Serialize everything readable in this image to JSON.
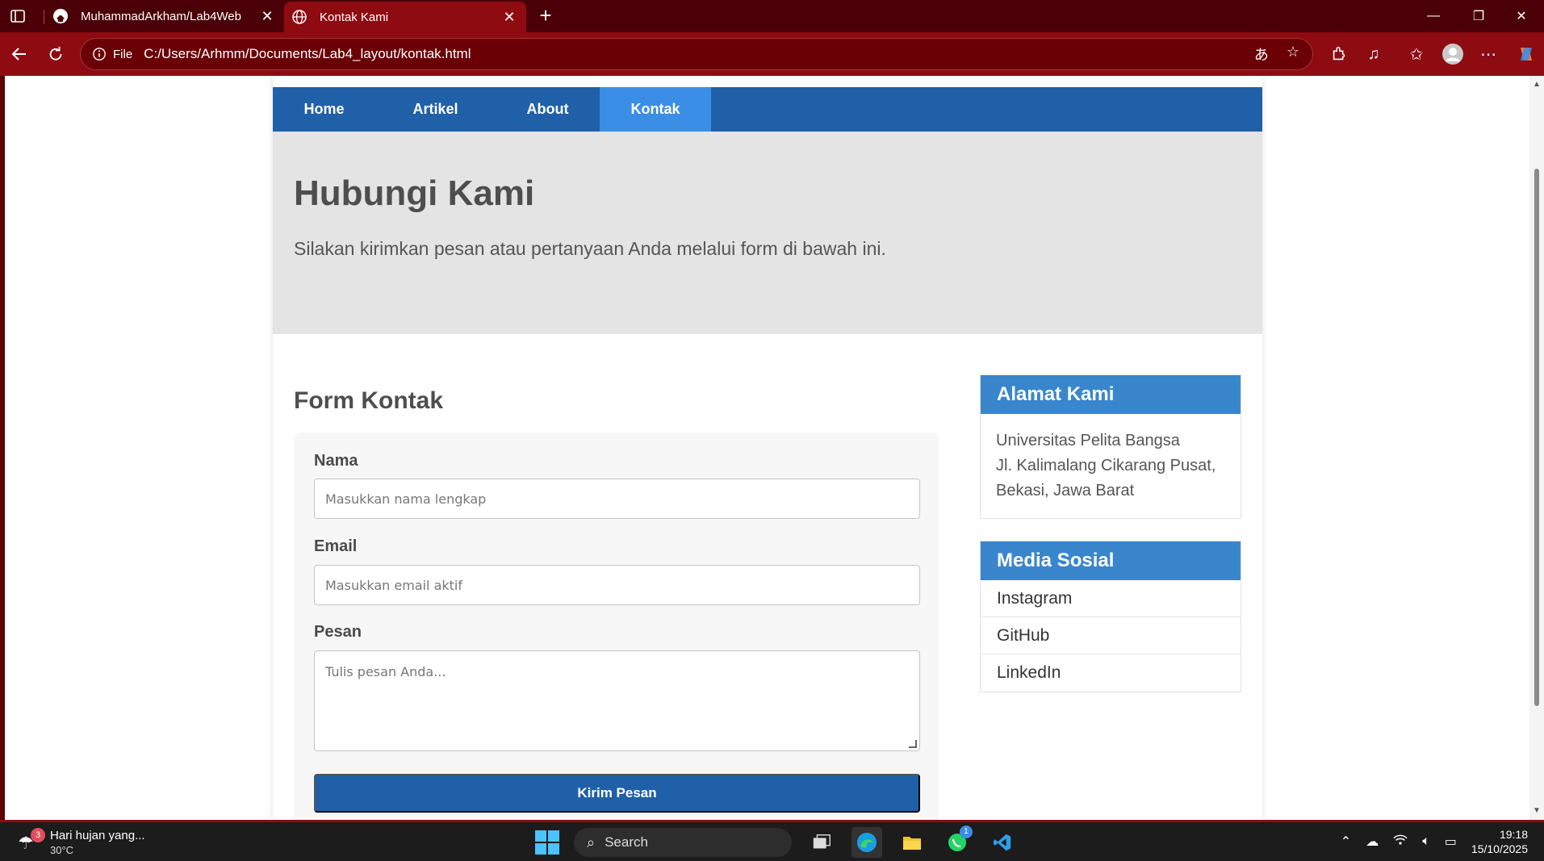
{
  "browser": {
    "tabs": [
      {
        "title": "MuhammadArkham/Lab4Web",
        "icon": "github-icon",
        "active": false
      },
      {
        "title": "Kontak Kami",
        "icon": "globe-icon",
        "active": true
      }
    ],
    "address": {
      "scheme_label": "File",
      "url": "C:/Users/Arhmm/Documents/Lab4_layout/kontak.html"
    }
  },
  "page": {
    "nav": [
      {
        "label": "Home",
        "active": false
      },
      {
        "label": "Artikel",
        "active": false
      },
      {
        "label": "About",
        "active": false
      },
      {
        "label": "Kontak",
        "active": true
      }
    ],
    "hero": {
      "title": "Hubungi Kami",
      "subtitle": "Silakan kirimkan pesan atau pertanyaan Anda melalui form di bawah ini."
    },
    "form": {
      "title": "Form Kontak",
      "name_label": "Nama",
      "name_placeholder": "Masukkan nama lengkap",
      "email_label": "Email",
      "email_placeholder": "Masukkan email aktif",
      "message_label": "Pesan",
      "message_placeholder": "Tulis pesan Anda...",
      "submit_label": "Kirim Pesan"
    },
    "sidebar": {
      "address": {
        "title": "Alamat Kami",
        "lines": [
          "Universitas Pelita Bangsa",
          "Jl. Kalimalang Cikarang Pusat,",
          "Bekasi, Jawa Barat"
        ]
      },
      "social": {
        "title": "Media Sosial",
        "links": [
          "Instagram",
          "GitHub",
          "LinkedIn"
        ]
      }
    }
  },
  "taskbar": {
    "weather_text": "Hari hujan yang...",
    "temperature": "30°C",
    "weather_badge": "3",
    "search_label": "Search",
    "whatsapp_badge": "1",
    "time": "19:18",
    "date": "15/10/2025"
  },
  "colors": {
    "chrome": "#8e0b12",
    "nav": "#2060a8",
    "nav_active": "#3a8ee6",
    "sidebar_header": "#3a86cc",
    "hero_bg": "#e4e4e4"
  }
}
